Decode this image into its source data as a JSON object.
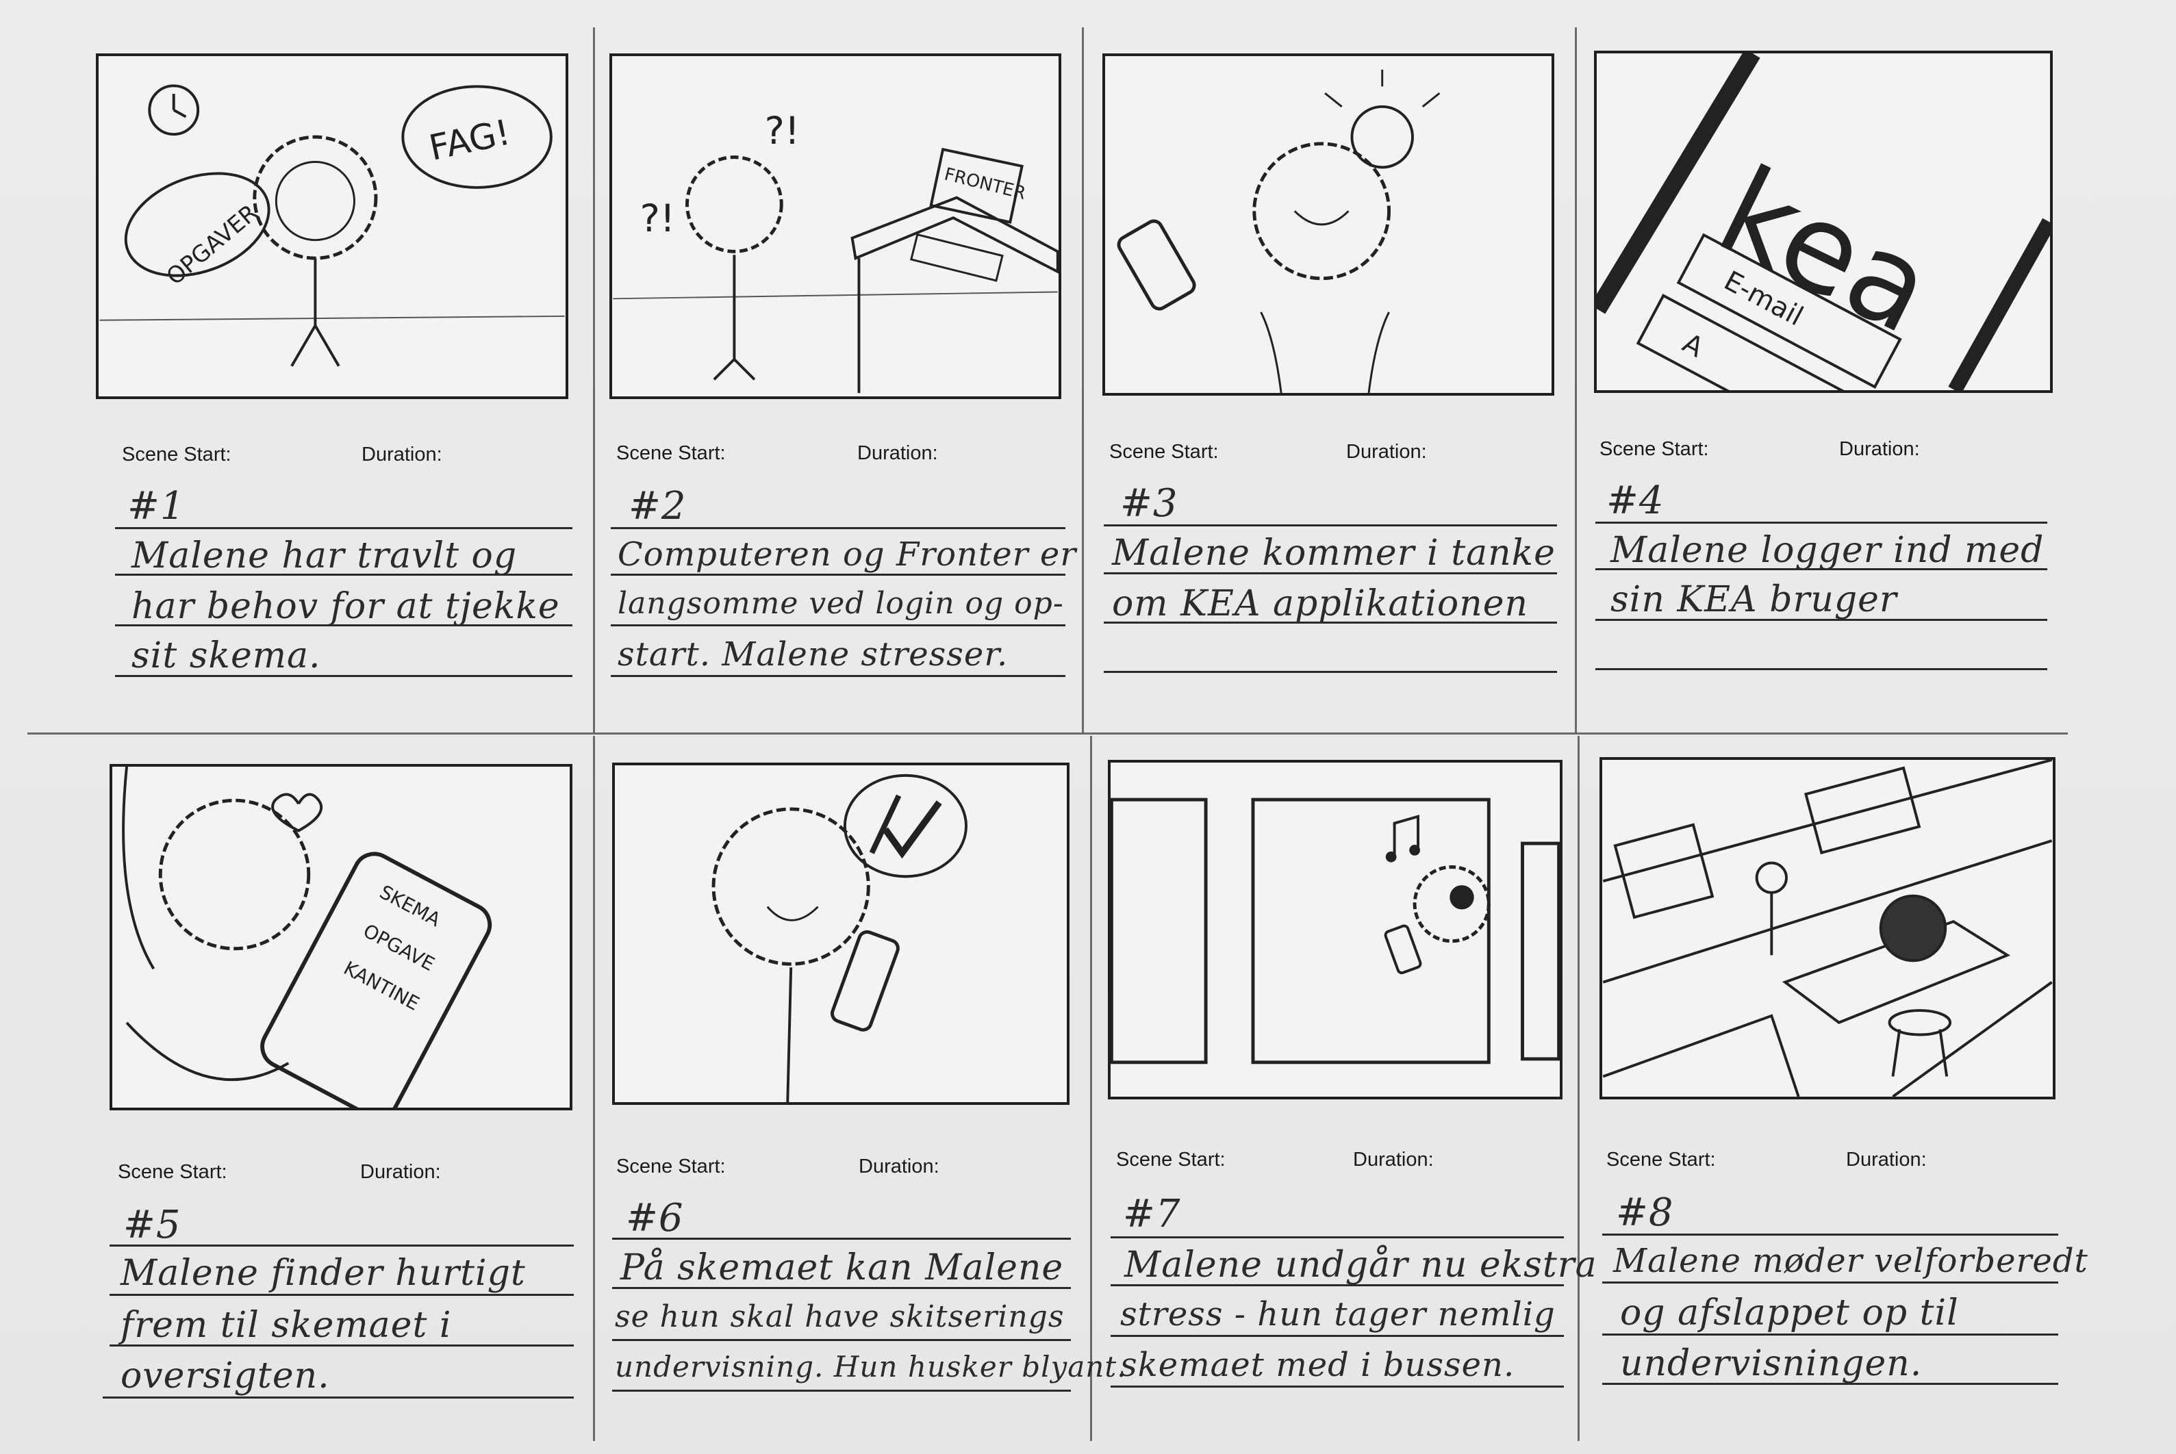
{
  "labels": {
    "scene_start": "Scene Start:",
    "duration": "Duration:"
  },
  "scenes": [
    {
      "num": "#1",
      "lines": [
        "Malene har travlt og",
        "har behov for at tjekke",
        "sit skema."
      ],
      "sketch": {
        "bubbles": [
          "OPGAVER",
          "FAG!"
        ]
      }
    },
    {
      "num": "#2",
      "lines": [
        "Computeren og Fronter er",
        "langsomme ved login og op-",
        "start. Malene stresser."
      ],
      "sketch": {
        "screen": "FRONTER",
        "marks": [
          "?!",
          "?!"
        ]
      }
    },
    {
      "num": "#3",
      "lines": [
        "Malene kommer i tanke",
        "om KEA applikationen",
        ""
      ]
    },
    {
      "num": "#4",
      "lines": [
        "Malene logger ind med",
        "sin KEA bruger",
        ""
      ],
      "sketch": {
        "logo": "kea",
        "field": "E-mail",
        "field2": "A"
      }
    },
    {
      "num": "#5",
      "lines": [
        "Malene finder hurtigt",
        "frem til skemaet i",
        "oversigten."
      ],
      "sketch": {
        "menu": [
          "SKEMA",
          "OPGAVE",
          "KANTINE"
        ]
      }
    },
    {
      "num": "#6",
      "lines": [
        "På skemaet kan Malene",
        "se hun skal have skitserings",
        "undervisning. Hun husker blyant."
      ]
    },
    {
      "num": "#7",
      "lines": [
        "Malene undgår nu ekstra",
        "stress - hun tager nemlig",
        "skemaet med i bussen."
      ]
    },
    {
      "num": "#8",
      "lines": [
        "Malene møder velforberedt",
        "og afslappet op til",
        "undervisningen."
      ]
    }
  ]
}
